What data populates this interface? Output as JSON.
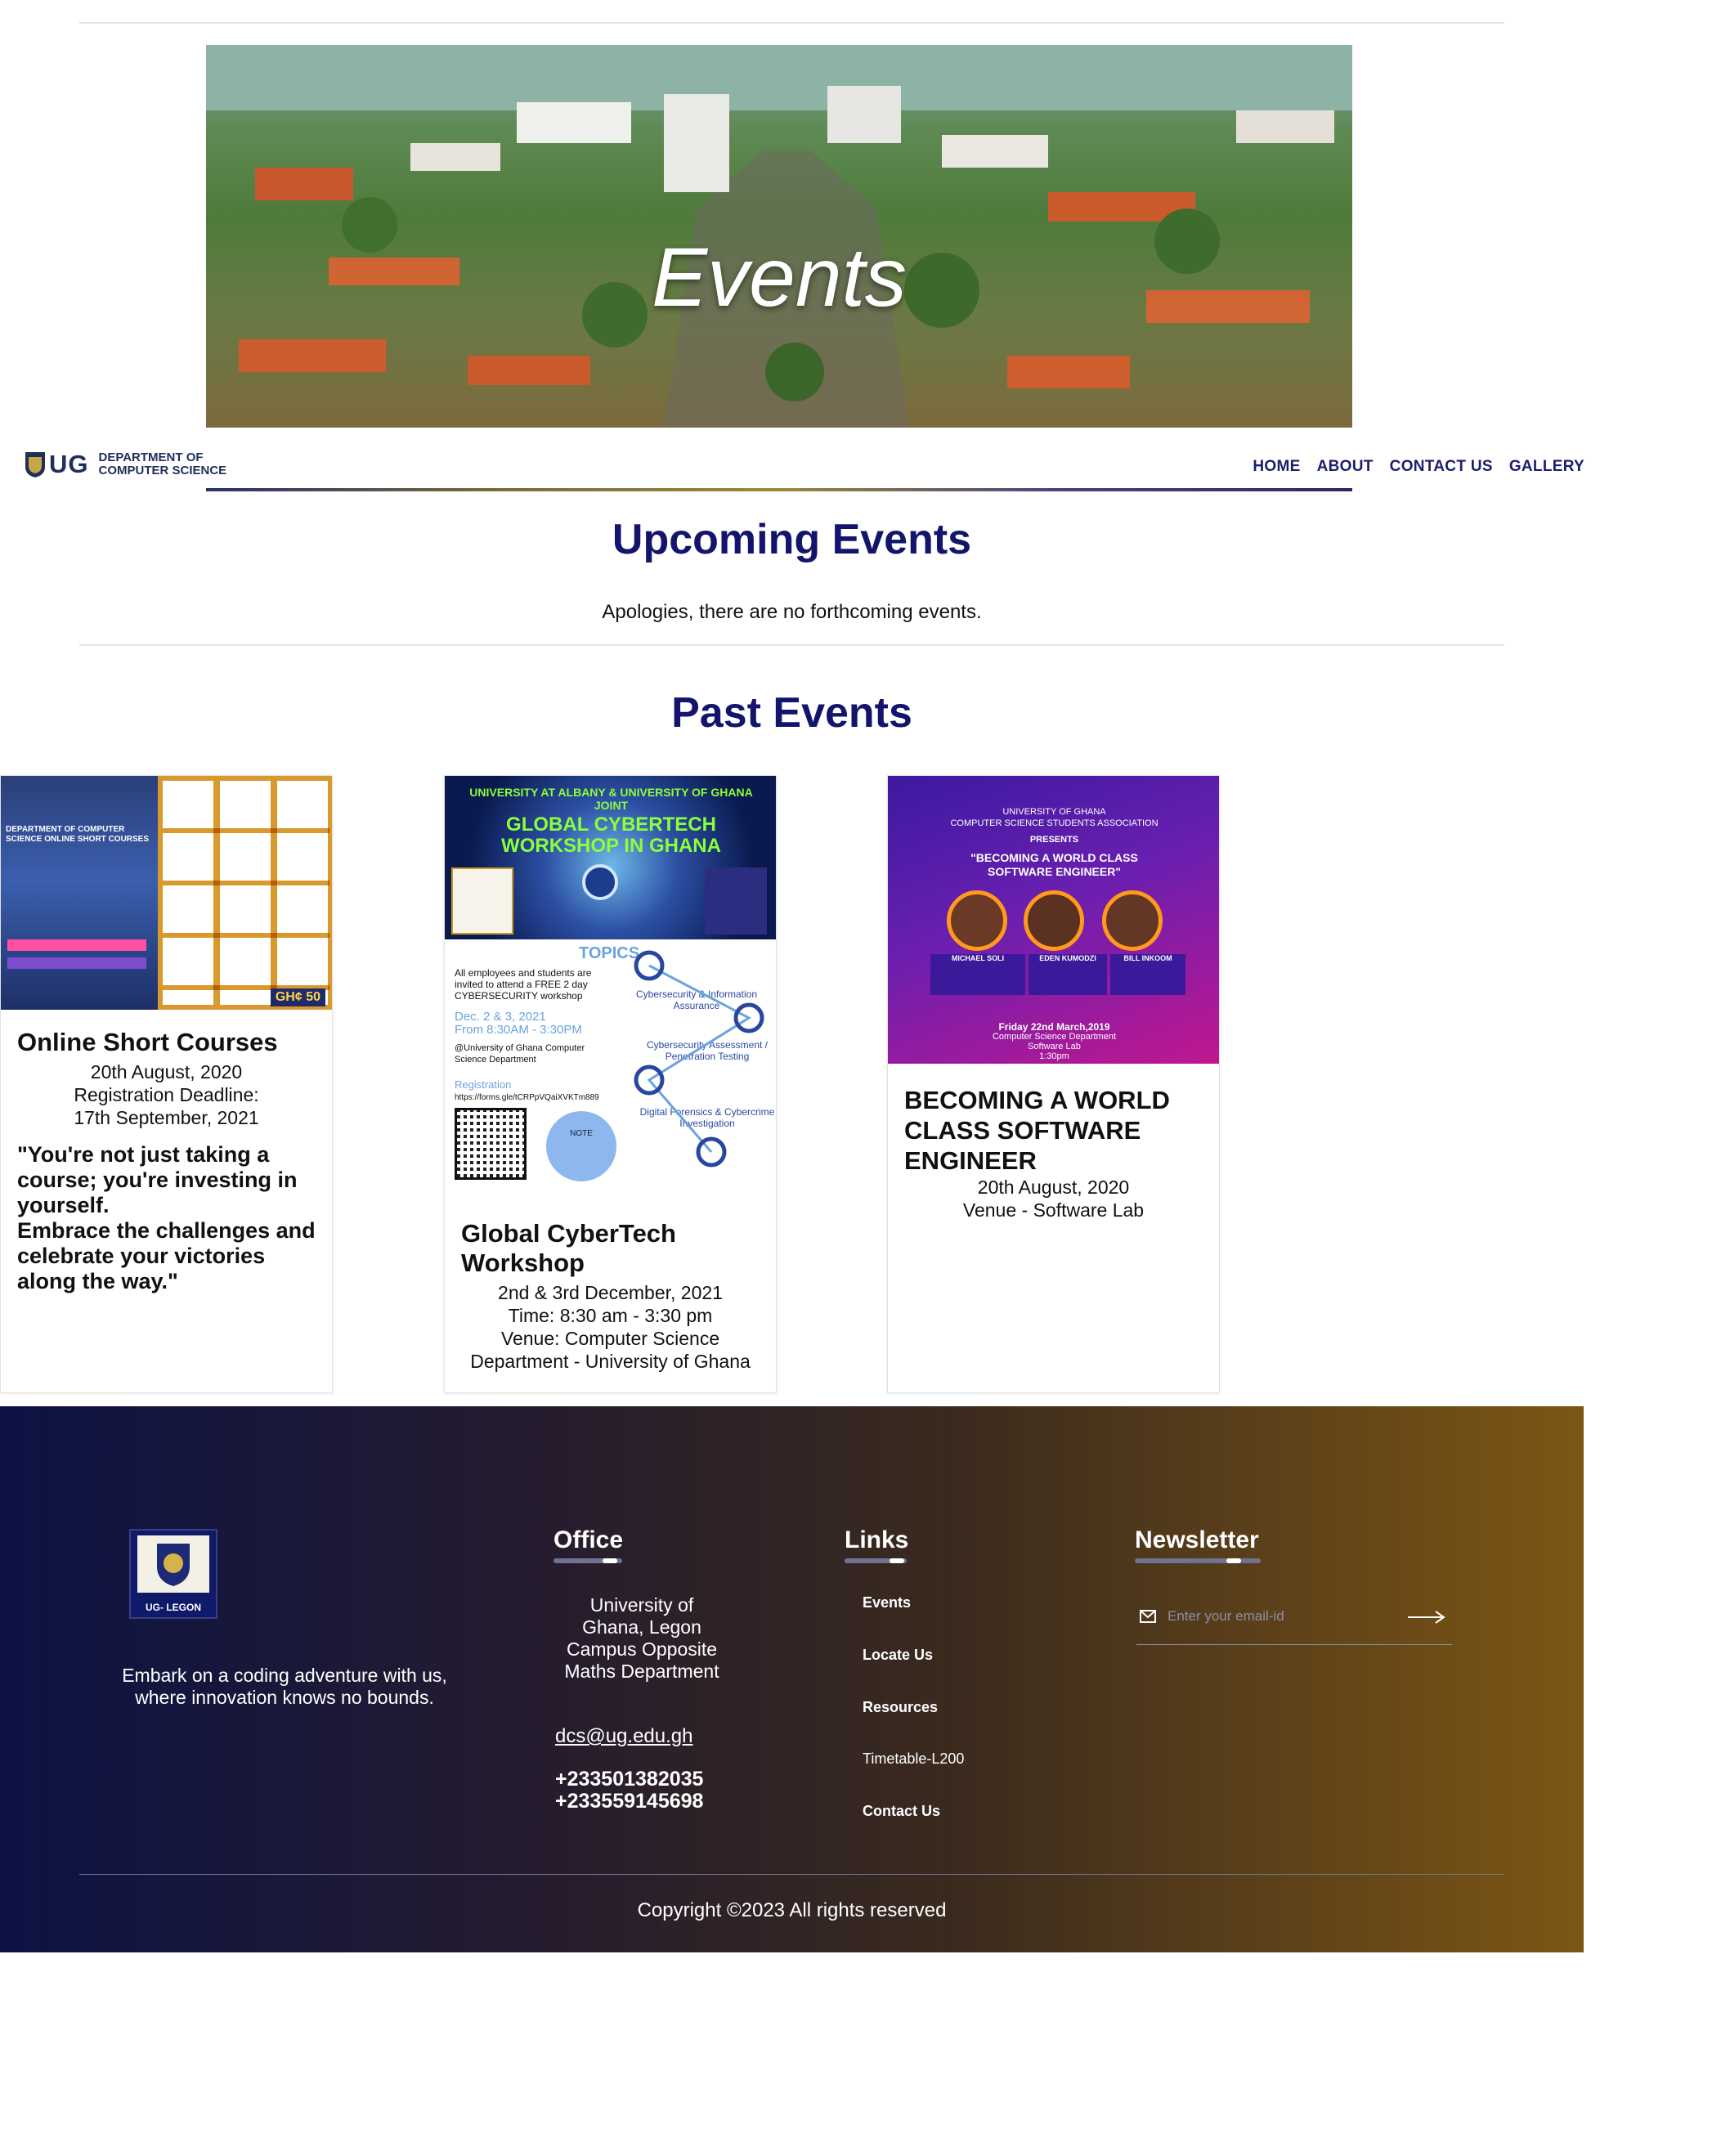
{
  "hero": {
    "title": "Events"
  },
  "navbar": {
    "logo_abbr": "UG",
    "logo_line1": "DEPARTMENT OF",
    "logo_line2": "COMPUTER SCIENCE",
    "items": [
      "HOME",
      "ABOUT",
      "CONTACT US",
      "GALLERY"
    ]
  },
  "upcoming": {
    "title": "Upcoming Events",
    "message": "Apologies, there are no forthcoming events."
  },
  "past": {
    "title": "Past Events",
    "cards": [
      {
        "title": "Online Short Courses",
        "lines": [
          "20th August, 2020",
          "Registration Deadline:",
          "17th September, 2021"
        ],
        "quote": "\"You're not just taking a course; you're investing in yourself.\nEmbrace the challenges and celebrate your victories along the way.\"",
        "poster": {
          "heading": "DEPARTMENT OF COMPUTER SCIENCE ONLINE SHORT COURSES",
          "price_badge": "GH¢ 50"
        }
      },
      {
        "title": "Global CyberTech Workshop",
        "lines": [
          "2nd & 3rd December, 2021",
          "Time: 8:30 am - 3:30 pm",
          "Venue: Computer Science",
          "Department - University of Ghana"
        ],
        "poster": {
          "line1": "UNIVERSITY AT ALBANY & UNIVERSITY OF GHANA",
          "line2": "JOINT",
          "line3": "GLOBAL CYBERTECH",
          "line4": "WORKSHOP IN GHANA",
          "topics": "TOPICS",
          "invite": "All employees and students are invited to attend a FREE 2 day CYBERSECURITY workshop",
          "dates": "Dec. 2 & 3, 2021",
          "time": "From 8:30AM - 3:30PM",
          "venue": "@University of Ghana Computer Science Department",
          "registration": "Registration",
          "url": "https://forms.gle/tCRPpVQaiXVKTm889",
          "topic1": "Cybersecurity & Information Assurance",
          "topic2": "Cybersecurity Assessment / Penetration Testing",
          "topic3": "Digital Forensics & Cybercrime Investigation",
          "note": "NOTE"
        }
      },
      {
        "title": "BECOMING A WORLD CLASS SOFTWARE ENGINEER",
        "lines": [
          "20th August, 2020",
          "Venue - Software Lab"
        ],
        "poster": {
          "org1": "UNIVERSITY OF GHANA",
          "org2": "COMPUTER SCIENCE STUDENTS ASSOCIATION",
          "presents": "PRESENTS",
          "headline": "\"BECOMING A WORLD CLASS SOFTWARE ENGINEER\"",
          "speakers": [
            "MICHAEL SOLI",
            "EDEN KUMODZI",
            "BILL INKOOM"
          ],
          "date": "Friday 22nd March,2019",
          "venue": "Computer Science Department",
          "room": "Software Lab",
          "time": "1:30pm"
        }
      }
    ]
  },
  "footer": {
    "tagline": "Embark on a coding adventure with us, where innovation knows no bounds.",
    "logo_caption": "UG- LEGON",
    "office_title": "Office",
    "address": "University of Ghana, Legon Campus Opposite Maths Department",
    "email": "dcs@ug.edu.gh",
    "phone1": "+233501382035",
    "phone2": "+233559145698",
    "links_title": "Links",
    "links": [
      "Events",
      "Locate Us",
      "Resources",
      "Timetable-L200",
      "Contact Us"
    ],
    "newsletter_title": "Newsletter",
    "newsletter_placeholder": "Enter your email-id",
    "copyright": "Copyright ©2023 All rights reserved"
  },
  "colors": {
    "navy": "#12156b",
    "footer_start": "#0c1344",
    "footer_end": "#7d5614"
  }
}
